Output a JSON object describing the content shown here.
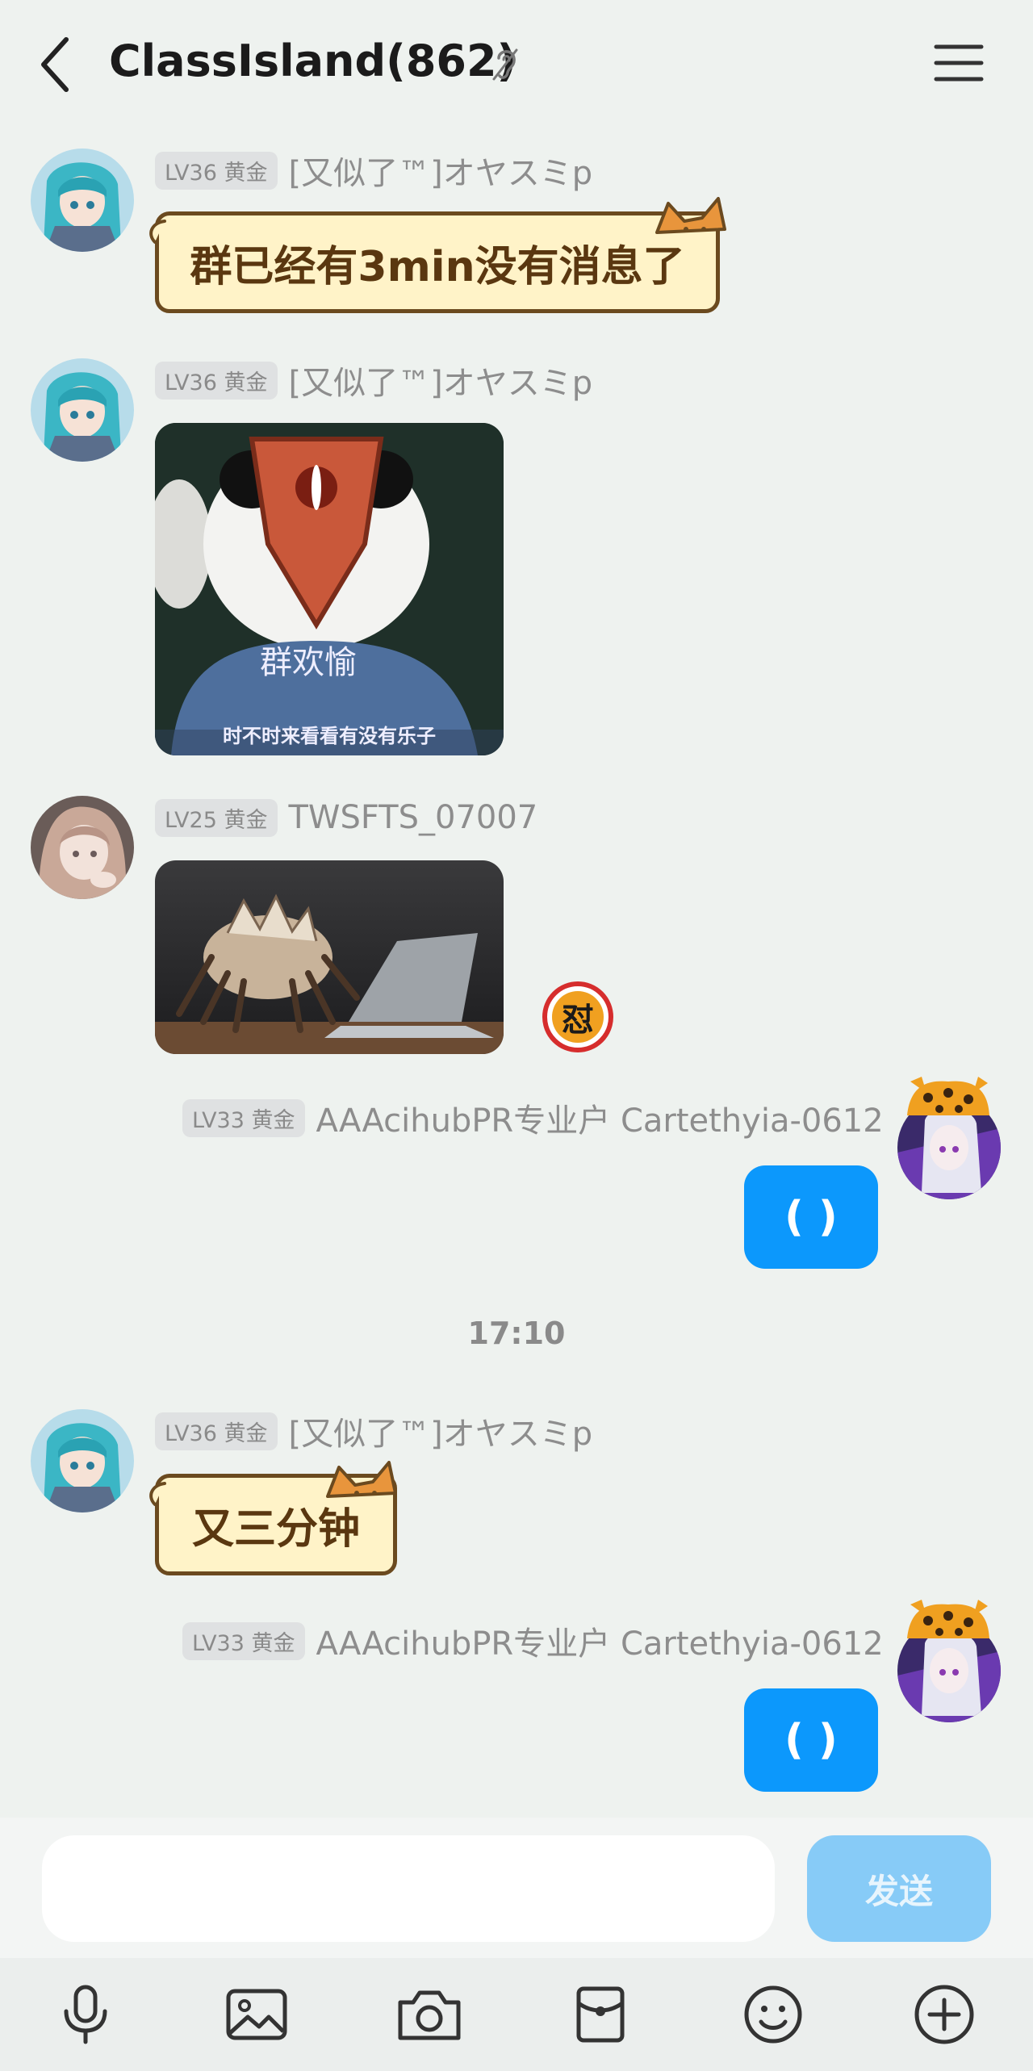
{
  "header": {
    "title": "ClassIsland(862)"
  },
  "messages": [
    {
      "level": "LV36 黄金",
      "sender": "[又似了™]オヤスミp",
      "text": "群已经有3min没有消息了"
    },
    {
      "level": "LV36 黄金",
      "sender": "[又似了™]オヤスミp",
      "image_caption": "群欢愉",
      "image_subcaption": "时不时来看看有没有乐子"
    },
    {
      "level": "LV25 黄金",
      "sender": "TWSFTS_07007",
      "reaction_glyph": "怼"
    },
    {
      "level": "LV33 黄金",
      "sender": "AAAcihubPR专业户 Cartethyia-0612",
      "text": "( )"
    },
    {
      "level": "LV36 黄金",
      "sender": "[又似了™]オヤスミp",
      "text": "又三分钟"
    },
    {
      "level": "LV33 黄金",
      "sender": "AAAcihubPR专业户 Cartethyia-0612",
      "text": "( )"
    }
  ],
  "time_divider": "17:10",
  "input": {
    "send_label": "发送"
  },
  "colors": {
    "background": "#eef2ef",
    "self_bubble": "#0c98fc",
    "send_button": "#87cbf7",
    "themed_bubble": "#fff3c8"
  },
  "toolbar_icons": [
    "microphone-icon",
    "image-icon",
    "camera-icon",
    "red-packet-icon",
    "emoji-icon",
    "plus-icon"
  ]
}
